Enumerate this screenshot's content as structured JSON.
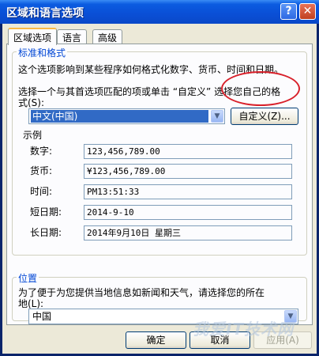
{
  "window": {
    "title": "区域和语言选项",
    "help_icon": "?",
    "close_icon": "✕"
  },
  "tabs": [
    "区域选项",
    "语言",
    "高级"
  ],
  "standards": {
    "legend": "标准和格式",
    "description": "这个选项影响到某些程序如何格式化数字、货币、时间和日期。",
    "instruction_line1": "选择一个与其首选项匹配的项或单击 “自定义” 选择您自己的格",
    "instruction_line2": "式(S):",
    "selected_locale": "中文(中国)",
    "customize_label": "自定义(Z)..."
  },
  "samples": {
    "legend": "示例",
    "rows": [
      {
        "label": "数字:",
        "value": "123,456,789.00"
      },
      {
        "label": "货币:",
        "value": "¥123,456,789.00"
      },
      {
        "label": "时间:",
        "value": "PM13:51:33"
      },
      {
        "label": "短日期:",
        "value": "2014-9-10"
      },
      {
        "label": "长日期:",
        "value": "2014年9月10日 星期三"
      }
    ]
  },
  "location": {
    "legend": "位置",
    "description_line1": "为了便于为您提供当地信息如新闻和天气，请选择您的所在",
    "description_line2": "地(L):",
    "selected_location": "中国"
  },
  "footer": {
    "ok_label": "确定",
    "cancel_label": "取消",
    "apply_label": "应用(A)"
  },
  "watermark_text": "我爱IT技术网",
  "colors": {
    "titlebar": "#0a4fd6",
    "highlight": "#316ac5",
    "annotation": "#d8202a",
    "group_legend": "#0046d5"
  },
  "dropdown_icon": "▼"
}
